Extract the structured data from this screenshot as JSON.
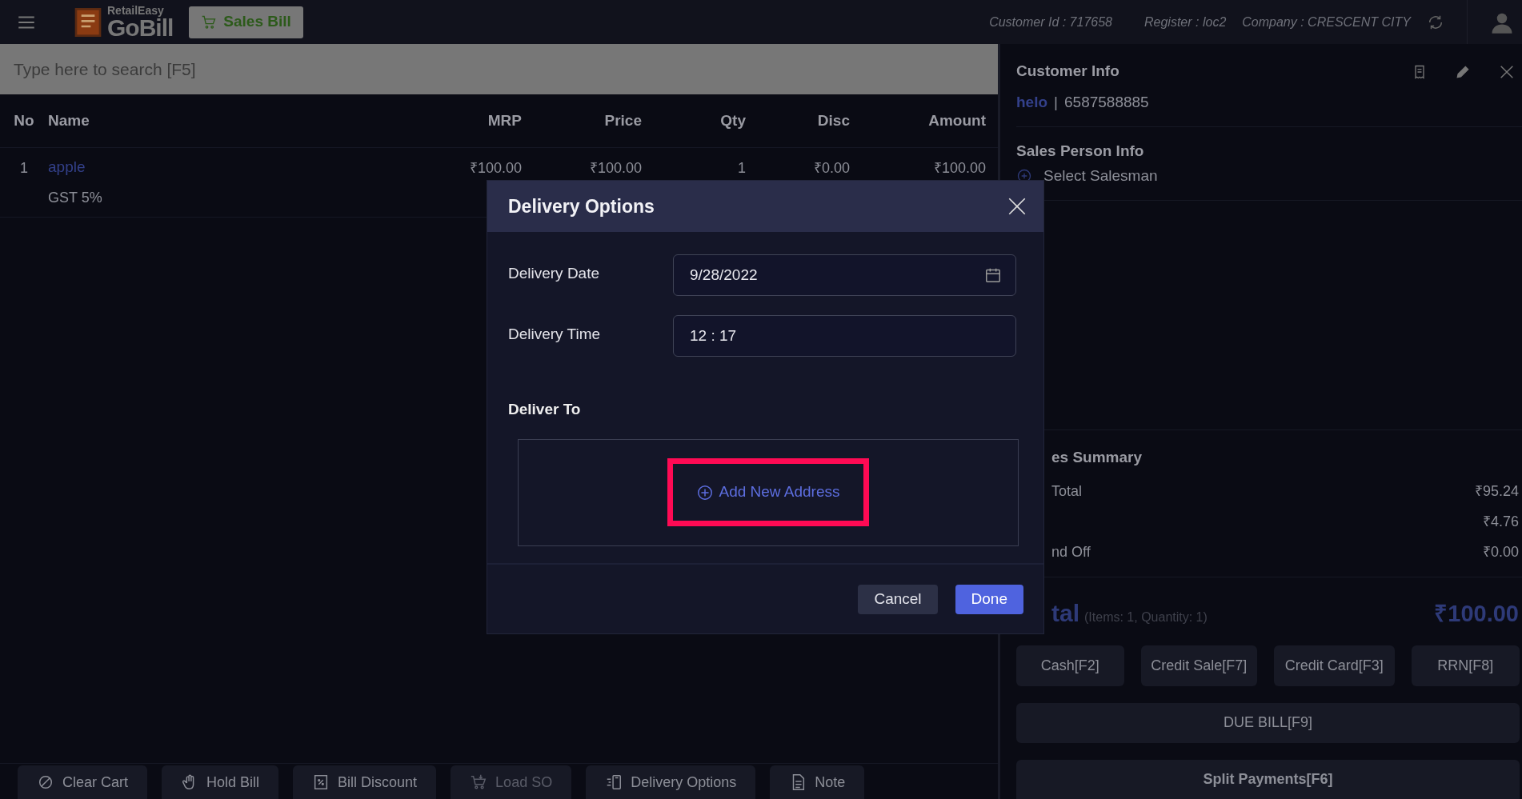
{
  "top_bar": {
    "app_name_small": "RetailEasy",
    "app_name": "GoBill",
    "mode_button": "Sales Bill",
    "customer_id": "Customer Id : 717658",
    "register": "Register : loc2",
    "company": "Company : CRESCENT CITY"
  },
  "search": {
    "placeholder": "Type here to search [F5]"
  },
  "table": {
    "columns": [
      "No",
      "Name",
      "MRP",
      "Price",
      "Qty",
      "Disc",
      "Amount"
    ],
    "rows": [
      {
        "no": "1",
        "name": "apple",
        "tax": "GST 5%",
        "mrp": "₹100.00",
        "price": "₹100.00",
        "qty": "1",
        "disc": "₹0.00",
        "amount": "₹100.00"
      }
    ]
  },
  "actions": [
    {
      "label": "Clear Cart",
      "disabled": false
    },
    {
      "label": "Hold Bill",
      "disabled": false
    },
    {
      "label": "Bill Discount",
      "disabled": false
    },
    {
      "label": "Load SO",
      "disabled": true
    },
    {
      "label": "Delivery Options",
      "disabled": false
    },
    {
      "label": "Note",
      "disabled": false
    }
  ],
  "customer": {
    "title": "Customer Info",
    "name": "helo",
    "separator": "|",
    "phone": "6587588885"
  },
  "sales_person": {
    "title": "Sales Person Info",
    "action": "Select Salesman"
  },
  "summary": {
    "title": "es Summary",
    "rows": [
      {
        "label": "Total",
        "value": "₹95.24"
      },
      {
        "value": "₹4.76"
      },
      {
        "label": "nd Off",
        "value": "₹0.00"
      }
    ]
  },
  "total": {
    "label": "tal",
    "detail": "(Items: 1, Quantity: 1)",
    "amount": "₹100.00"
  },
  "payments": [
    "Cash[F2]",
    "Credit Sale[F7]",
    "Credit Card[F3]",
    "RRN[F8]"
  ],
  "due_bill": "DUE BILL[F9]",
  "split_payments": "Split Payments[F6]",
  "modal": {
    "title": "Delivery Options",
    "fields": [
      {
        "label": "Delivery Date",
        "value": "9/28/2022",
        "kind": "date"
      },
      {
        "label": "Delivery Time",
        "value": "12 : 17",
        "kind": "time"
      }
    ],
    "deliver_to": "Deliver To",
    "add_address": "Add New Address",
    "buttons": [
      {
        "label": "Cancel",
        "kind": "secondary"
      },
      {
        "label": "Done",
        "kind": "primary"
      }
    ]
  }
}
